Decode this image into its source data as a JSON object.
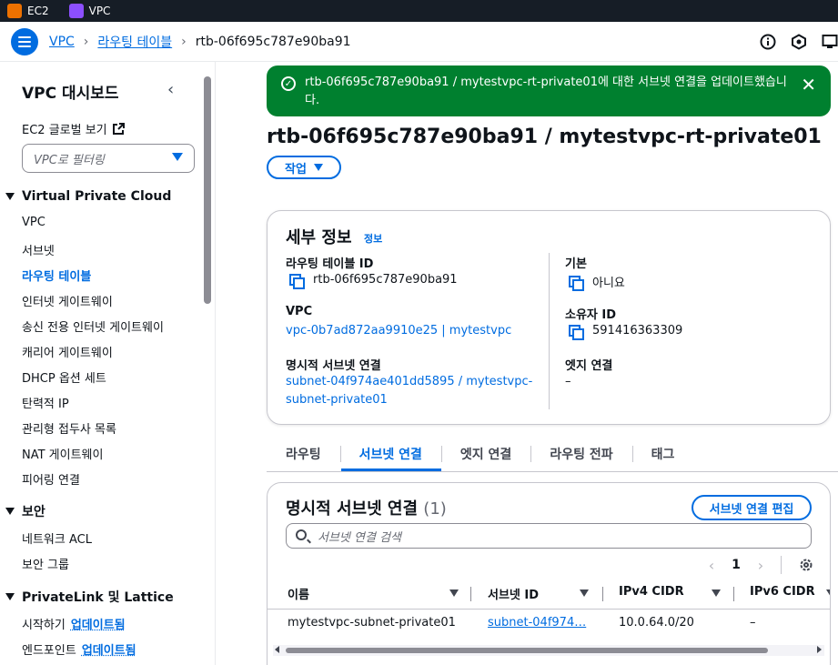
{
  "topbar": {
    "services": [
      {
        "label": "EC2",
        "icon": "ec2-icon"
      },
      {
        "label": "VPC",
        "icon": "vpc-icon"
      }
    ]
  },
  "breadcrumb": {
    "items": [
      "VPC",
      "라우팅 테이블",
      "rtb-06f695c787e90ba91"
    ]
  },
  "sidebar": {
    "title": "VPC 대시보드",
    "global_view": "EC2 글로벌 보기",
    "filter_placeholder": "VPC로 필터링",
    "sections": [
      {
        "title": "Virtual Private Cloud",
        "items": [
          "VPC",
          "서브넷",
          "라우팅 테이블",
          "인터넷 게이트웨이",
          "송신 전용 인터넷 게이트웨이",
          "캐리어 게이트웨이",
          "DHCP 옵션 세트",
          "탄력적 IP",
          "관리형 접두사 목록",
          "NAT 게이트웨이",
          "피어링 연결"
        ]
      },
      {
        "title": "보안",
        "items": [
          "네트워크 ACL",
          "보안 그룹"
        ]
      },
      {
        "title": "PrivateLink 및 Lattice",
        "items": [
          "시작하기",
          "엔드포인트"
        ]
      }
    ],
    "active_item": "라우팅 테이블",
    "update_badge": "업데이트됨"
  },
  "flash": {
    "message": "rtb-06f695c787e90ba91 / mytestvpc-rt-private01에 대한 서브넷 연결을 업데이트했습니다."
  },
  "page": {
    "title": "rtb-06f695c787e90ba91 / mytestvpc-rt-private01",
    "actions_label": "작업"
  },
  "details": {
    "title": "세부 정보",
    "info": "정보",
    "route_table_id_label": "라우팅 테이블 ID",
    "route_table_id": "rtb-06f695c787e90ba91",
    "main_label": "기본",
    "main_value": "아니요",
    "vpc_label": "VPC",
    "vpc_value": "vpc-0b7ad872aa9910e25 | mytestvpc",
    "owner_label": "소유자 ID",
    "owner_value": "591416363309",
    "explicit_label": "명시적 서브넷 연결",
    "explicit_value_1": "subnet-04f974ae401dd5895 / mytestvpc-",
    "explicit_value_2": "subnet-private01",
    "edge_label": "엣지 연결",
    "edge_value": "–"
  },
  "tabs": [
    "라우팅",
    "서브넷 연결",
    "엣지 연결",
    "라우팅 전파",
    "태그"
  ],
  "active_tab": "서브넷 연결",
  "subnet_assoc": {
    "title": "명시적 서브넷 연결",
    "count": "(1)",
    "edit_button": "서브넷 연결 편집",
    "search_placeholder": "서브넷 연결 검색",
    "page_number": "1",
    "columns": [
      "이름",
      "서브넷 ID",
      "IPv4 CIDR",
      "IPv6 CIDR"
    ],
    "rows": [
      {
        "name": "mytestvpc-subnet-private01",
        "subnet_id": "subnet-04f974…",
        "ipv4": "10.0.64.0/20",
        "ipv6": "–"
      }
    ]
  },
  "colors": {
    "accent": "#006ce0",
    "success": "#00802f",
    "topbar": "#161d26"
  }
}
